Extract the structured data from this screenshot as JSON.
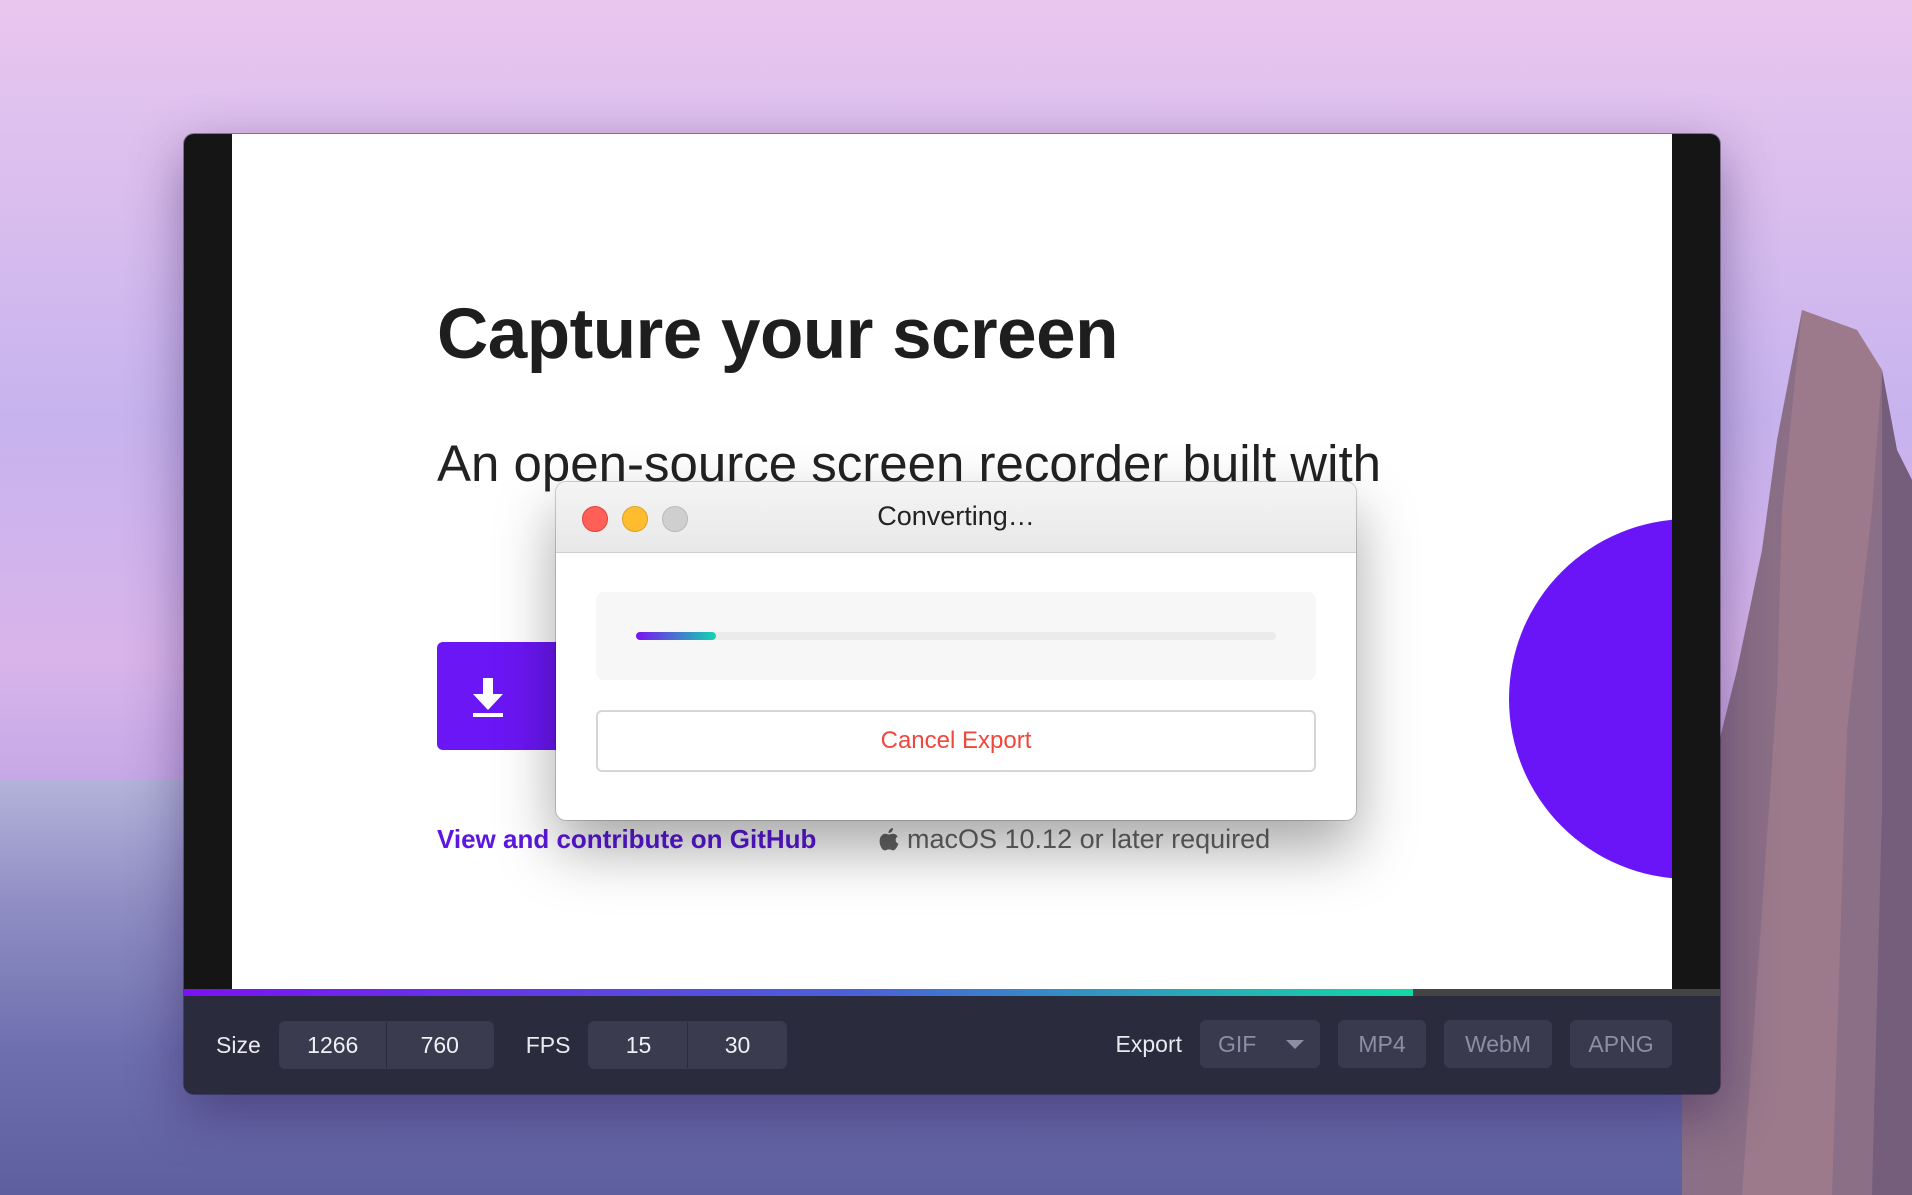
{
  "preview": {
    "heading": "Capture your screen",
    "subheading": "An open-source screen recorder built with",
    "github_link": "View and contribute on GitHub",
    "requirement": "macOS 10.12 or later required"
  },
  "dialog": {
    "title": "Converting…",
    "progress": 0.125,
    "cancel_label": "Cancel Export"
  },
  "toolbar": {
    "size_label": "Size",
    "width": "1266",
    "height": "760",
    "fps_label": "FPS",
    "fps_options": [
      "15",
      "30"
    ],
    "export_label": "Export",
    "formats": [
      "GIF",
      "MP4",
      "WebM",
      "APNG"
    ]
  },
  "timeline": {
    "progress": 0.8
  },
  "colors": {
    "accent_purple": "#6b16f5",
    "accent_teal": "#12d9a5",
    "cancel_red": "#f0473d",
    "toolbar_bg": "#2b2b3e"
  },
  "icons": [
    "download-icon",
    "apple-icon",
    "close-light-icon",
    "minimize-light-icon",
    "zoom-light-icon",
    "dropdown-caret-icon"
  ]
}
